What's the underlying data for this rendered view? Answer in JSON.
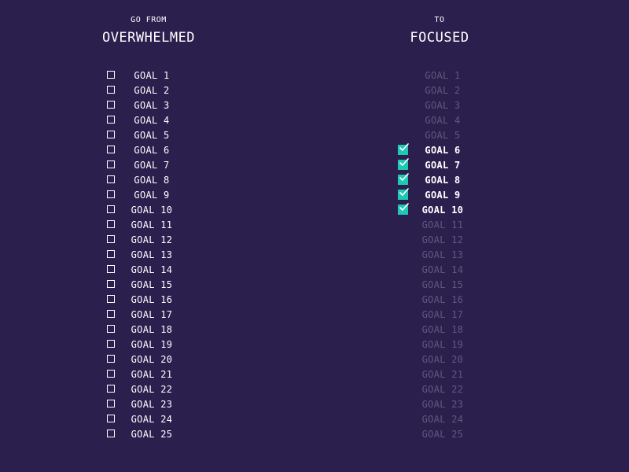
{
  "left": {
    "subtitle": "GO FROM",
    "title": "OVERWHELMED",
    "goals": [
      {
        "label": "GOAL 1"
      },
      {
        "label": "GOAL 2"
      },
      {
        "label": "GOAL 3"
      },
      {
        "label": "GOAL 4"
      },
      {
        "label": "GOAL 5"
      },
      {
        "label": "GOAL 6"
      },
      {
        "label": "GOAL 7"
      },
      {
        "label": "GOAL 8"
      },
      {
        "label": "GOAL 9"
      },
      {
        "label": "GOAL 10"
      },
      {
        "label": "GOAL 11"
      },
      {
        "label": "GOAL 12"
      },
      {
        "label": "GOAL 13"
      },
      {
        "label": "GOAL 14"
      },
      {
        "label": "GOAL 15"
      },
      {
        "label": "GOAL 16"
      },
      {
        "label": "GOAL 17"
      },
      {
        "label": "GOAL 18"
      },
      {
        "label": "GOAL 19"
      },
      {
        "label": "GOAL 20"
      },
      {
        "label": "GOAL 21"
      },
      {
        "label": "GOAL 22"
      },
      {
        "label": "GOAL 23"
      },
      {
        "label": "GOAL 24"
      },
      {
        "label": "GOAL 25"
      }
    ]
  },
  "right": {
    "subtitle": "TO",
    "title": "FOCUSED",
    "goals": [
      {
        "label": "GOAL 1",
        "checked": false
      },
      {
        "label": "GOAL 2",
        "checked": false
      },
      {
        "label": "GOAL 3",
        "checked": false
      },
      {
        "label": "GOAL 4",
        "checked": false
      },
      {
        "label": "GOAL 5",
        "checked": false
      },
      {
        "label": "GOAL 6",
        "checked": true
      },
      {
        "label": "GOAL 7",
        "checked": true
      },
      {
        "label": "GOAL 8",
        "checked": true
      },
      {
        "label": "GOAL 9",
        "checked": true
      },
      {
        "label": "GOAL 10",
        "checked": true
      },
      {
        "label": "GOAL 11",
        "checked": false
      },
      {
        "label": "GOAL 12",
        "checked": false
      },
      {
        "label": "GOAL 13",
        "checked": false
      },
      {
        "label": "GOAL 14",
        "checked": false
      },
      {
        "label": "GOAL 15",
        "checked": false
      },
      {
        "label": "GOAL 16",
        "checked": false
      },
      {
        "label": "GOAL 17",
        "checked": false
      },
      {
        "label": "GOAL 18",
        "checked": false
      },
      {
        "label": "GOAL 19",
        "checked": false
      },
      {
        "label": "GOAL 20",
        "checked": false
      },
      {
        "label": "GOAL 21",
        "checked": false
      },
      {
        "label": "GOAL 22",
        "checked": false
      },
      {
        "label": "GOAL 23",
        "checked": false
      },
      {
        "label": "GOAL 24",
        "checked": false
      },
      {
        "label": "GOAL 25",
        "checked": false
      }
    ]
  },
  "colors": {
    "background": "#2b1f4e",
    "accent": "#1ec8b3",
    "text": "#ffffff"
  }
}
